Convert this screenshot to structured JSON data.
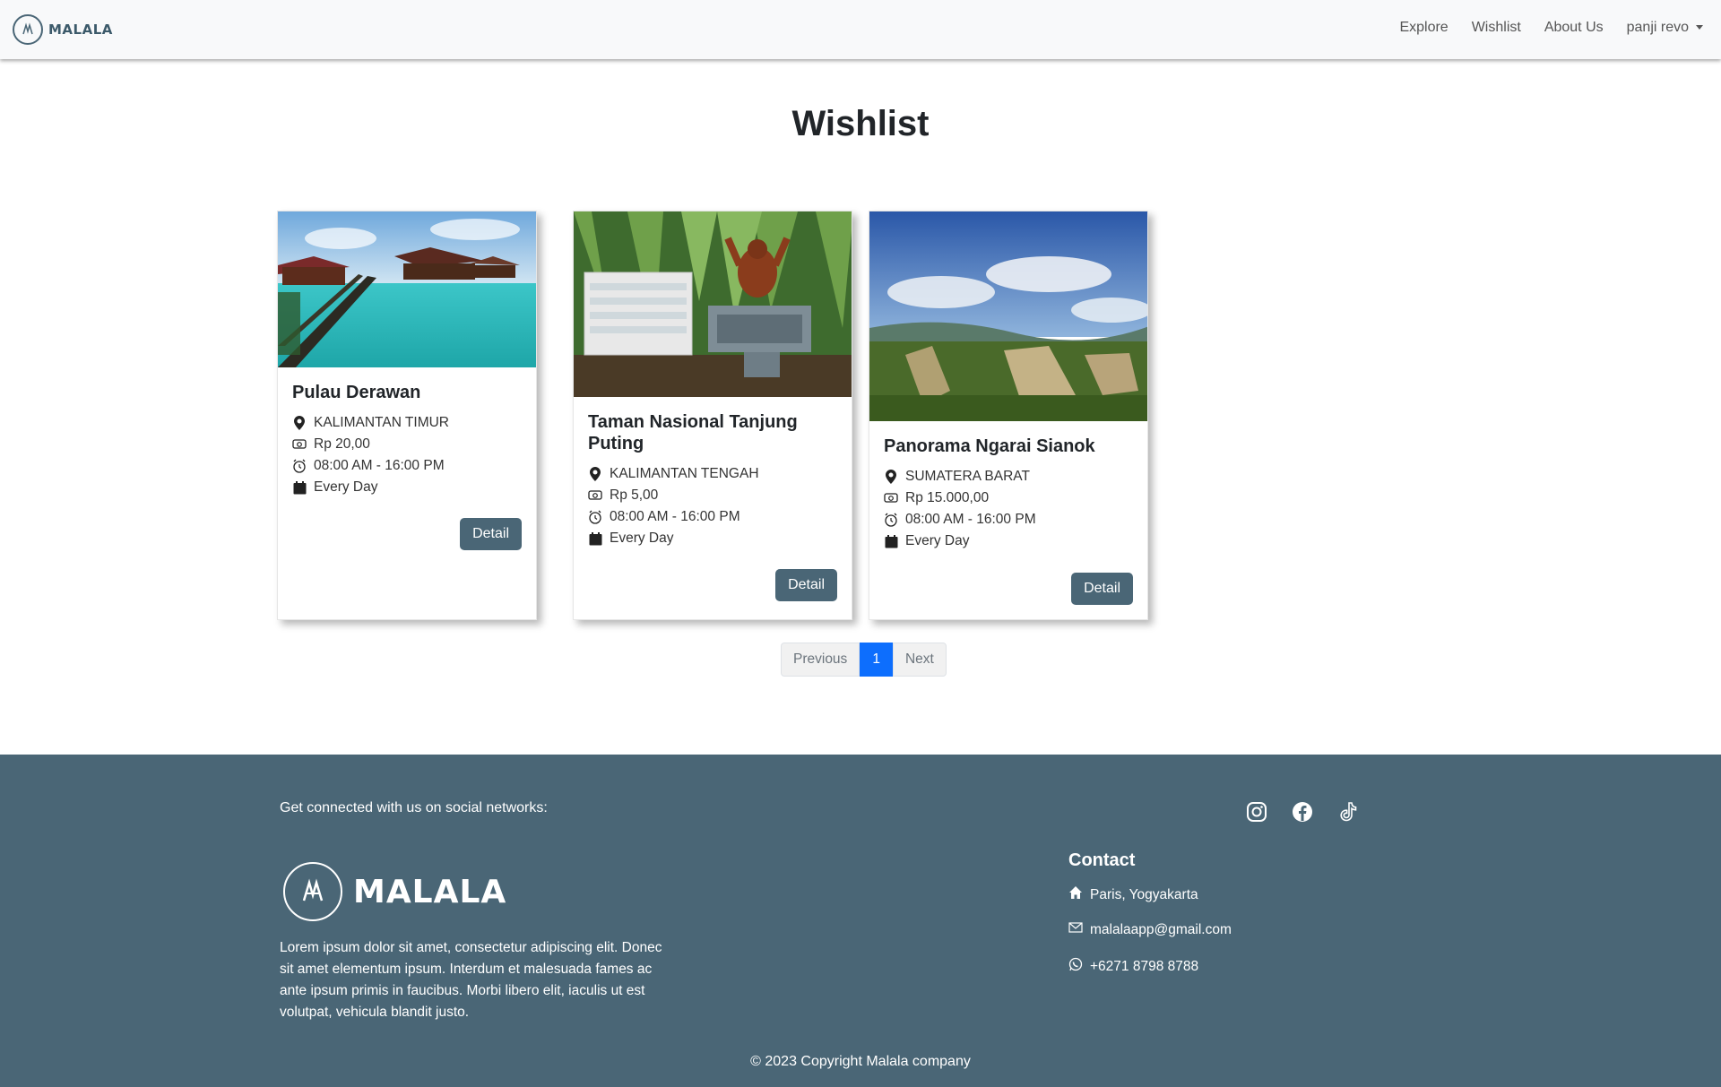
{
  "navbar": {
    "brand": "MALALA",
    "links": [
      "Explore",
      "Wishlist",
      "About Us"
    ],
    "user": "panji revo"
  },
  "page_title": "Wishlist",
  "cards": [
    {
      "title": "Pulau Derawan",
      "location": "KALIMANTAN TIMUR",
      "price": "Rp 20,00",
      "hours": "08:00 AM - 16:00 PM",
      "days": "Every Day",
      "button": "Detail"
    },
    {
      "title": "Taman Nasional Tanjung Puting",
      "location": "KALIMANTAN TENGAH",
      "price": "Rp 5,00",
      "hours": "08:00 AM - 16:00 PM",
      "days": "Every Day",
      "button": "Detail"
    },
    {
      "title": "Panorama Ngarai Sianok",
      "location": "SUMATERA BARAT",
      "price": "Rp 15.000,00",
      "hours": "08:00 AM - 16:00 PM",
      "days": "Every Day",
      "button": "Detail"
    }
  ],
  "pagination": {
    "previous": "Previous",
    "current": "1",
    "next": "Next"
  },
  "footer": {
    "social_text": "Get connected with us on social networks:",
    "brand": "MALALA",
    "description": "Lorem ipsum dolor sit amet, consectetur adipiscing elit. Donec sit amet elementum ipsum. Interdum et malesuada fames ac ante ipsum primis in faucibus. Morbi libero elit, iaculis ut est volutpat, vehicula blandit justo.",
    "contact_title": "Contact",
    "address": "Paris, Yogyakarta",
    "email": "malalaapp@gmail.com",
    "phone": "+6271 8798 8788",
    "copyright": "© 2023 Copyright Malala company"
  },
  "colors": {
    "primary": "#4a6676",
    "active_page": "#0d6efd",
    "navbar_bg": "#f8f9fa"
  }
}
